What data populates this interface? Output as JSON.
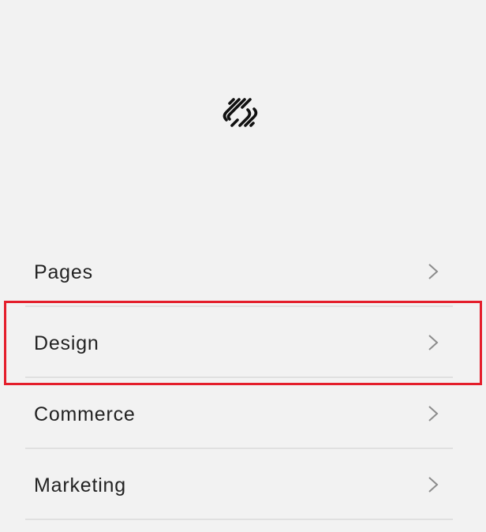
{
  "brand": {
    "logo_icon": "squarespace-logo-icon"
  },
  "menu": {
    "items": [
      {
        "label": "Pages",
        "icon": "chevron-right-icon"
      },
      {
        "label": "Design",
        "icon": "chevron-right-icon"
      },
      {
        "label": "Commerce",
        "icon": "chevron-right-icon"
      },
      {
        "label": "Marketing",
        "icon": "chevron-right-icon"
      }
    ],
    "highlighted_item": "Design"
  },
  "colors": {
    "background": "#f2f2f2",
    "text": "#222222",
    "chevron": "#8c8c8c",
    "divider": "#e0e0e0",
    "highlight": "#e41e2b"
  }
}
